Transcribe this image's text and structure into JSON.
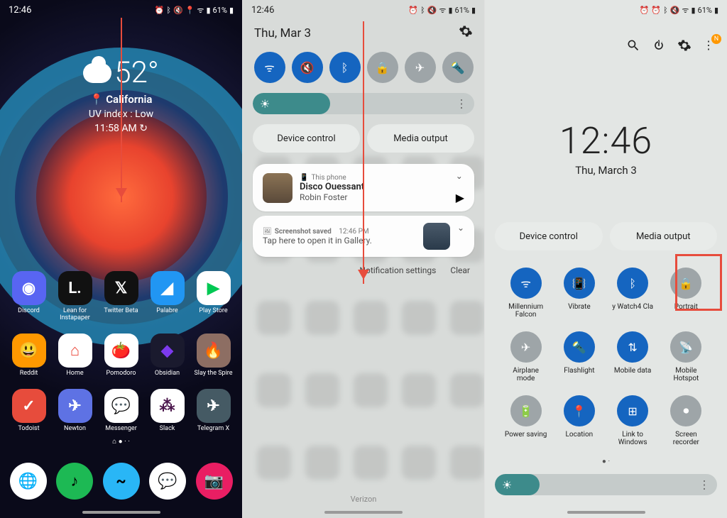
{
  "status": {
    "time": "12:46",
    "battery_pct": "61%",
    "icons": [
      "alarm",
      "bluetooth",
      "mute",
      "location",
      "wifi",
      "signal",
      "battery"
    ]
  },
  "panel1": {
    "weather": {
      "temp": "52°",
      "location": "California",
      "uv": "UV index : Low",
      "time": "11:58 AM"
    },
    "apps": [
      {
        "label": "Discord",
        "bg": "#5865f2",
        "fg": "#fff",
        "glyph": "◉"
      },
      {
        "label": "Lean for Instapaper",
        "bg": "#111",
        "fg": "#fff",
        "glyph": "L."
      },
      {
        "label": "Twitter Beta",
        "bg": "#111",
        "fg": "#fff",
        "glyph": "𝕏"
      },
      {
        "label": "Palabre",
        "bg": "#2196f3",
        "fg": "#fff",
        "glyph": "◢"
      },
      {
        "label": "Play Store",
        "bg": "#fff",
        "fg": "#00c853",
        "glyph": "▶"
      },
      {
        "label": "Reddit",
        "bg": "#ff9800",
        "fg": "#fff",
        "glyph": "😃"
      },
      {
        "label": "Home",
        "bg": "#fff",
        "fg": "#ea4335",
        "glyph": "⌂"
      },
      {
        "label": "Pomodoro",
        "bg": "#fff",
        "fg": "#e53935",
        "glyph": "🍅"
      },
      {
        "label": "Obsidian",
        "bg": "#1a1a2e",
        "fg": "#7c3aed",
        "glyph": "◆"
      },
      {
        "label": "Slay the Spire",
        "bg": "#8d6e63",
        "fg": "#ffc107",
        "glyph": "🔥"
      },
      {
        "label": "Todoist",
        "bg": "#e74c3c",
        "fg": "#fff",
        "glyph": "✓"
      },
      {
        "label": "Newton",
        "bg": "#5e72e4",
        "fg": "#fff",
        "glyph": "✈"
      },
      {
        "label": "Messenger",
        "bg": "#fff",
        "fg": "#e91e63",
        "glyph": "💬"
      },
      {
        "label": "Slack",
        "bg": "#fff",
        "fg": "#4a154b",
        "glyph": "⁂"
      },
      {
        "label": "Telegram X",
        "bg": "#455a64",
        "fg": "#fff",
        "glyph": "✈"
      }
    ],
    "dock": [
      {
        "bg": "#fff",
        "glyph": "🌐",
        "name": "chrome"
      },
      {
        "bg": "#1db954",
        "glyph": "♪",
        "name": "spotify"
      },
      {
        "bg": "#29b6f6",
        "glyph": "~",
        "name": "swipe"
      },
      {
        "bg": "#fff",
        "glyph": "💬",
        "name": "messages"
      },
      {
        "bg": "#e91e63",
        "glyph": "📷",
        "name": "camera"
      }
    ]
  },
  "panel2": {
    "date": "Thu, Mar 3",
    "tiles": [
      {
        "name": "wifi",
        "on": true
      },
      {
        "name": "sound-mute",
        "on": true
      },
      {
        "name": "bluetooth",
        "on": true
      },
      {
        "name": "rotation-lock",
        "on": false
      },
      {
        "name": "airplane",
        "on": false
      },
      {
        "name": "flashlight",
        "on": false
      }
    ],
    "device_control": "Device control",
    "media_output": "Media output",
    "notification1": {
      "source": "This phone",
      "title": "Disco Ouessant",
      "subtitle": "Robin Foster"
    },
    "notification2": {
      "title": "Screenshot saved",
      "time": "12:46 PM",
      "subtitle": "Tap here to open it in Gallery."
    },
    "settings_link": "Notification settings",
    "clear": "Clear",
    "carrier": "Verizon"
  },
  "panel3": {
    "big_time": "12:46",
    "big_date": "Thu, March 3",
    "device_control": "Device control",
    "media_output": "Media output",
    "tiles": [
      {
        "label": "Millennium Falcon",
        "name": "wifi",
        "on": true
      },
      {
        "label": "Vibrate",
        "name": "vibrate",
        "on": true
      },
      {
        "label": "y Watch4 Cla",
        "name": "bluetooth",
        "on": true
      },
      {
        "label": "Portrait",
        "name": "rotation",
        "on": false
      },
      {
        "label": "Airplane mode",
        "name": "airplane",
        "on": false
      },
      {
        "label": "Flashlight",
        "name": "flashlight",
        "on": true
      },
      {
        "label": "Mobile data",
        "name": "mobile-data",
        "on": true
      },
      {
        "label": "Mobile Hotspot",
        "name": "hotspot",
        "on": false
      },
      {
        "label": "Power saving",
        "name": "power-saving",
        "on": false
      },
      {
        "label": "Location",
        "name": "location",
        "on": true
      },
      {
        "label": "Link to Windows",
        "name": "link-windows",
        "on": true
      },
      {
        "label": "Screen recorder",
        "name": "screen-recorder",
        "on": false
      }
    ]
  }
}
